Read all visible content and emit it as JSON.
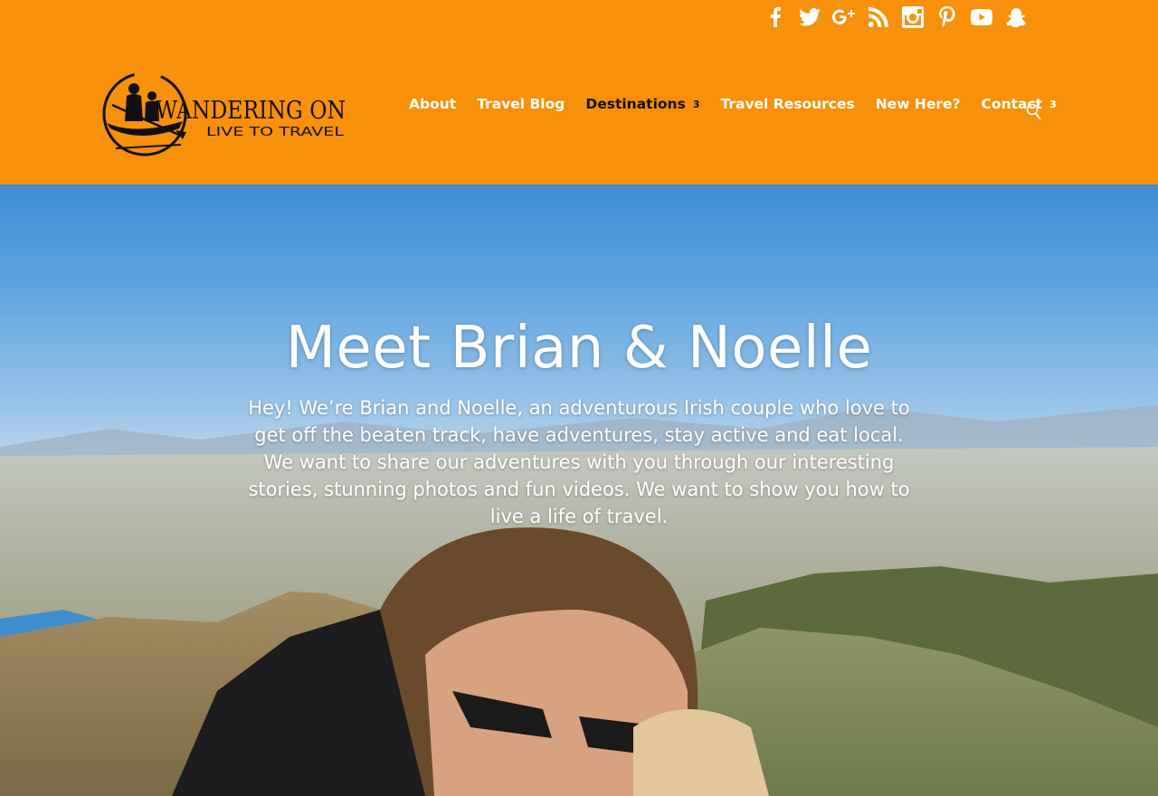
{
  "header": {
    "social": [
      {
        "icon": "facebook-icon"
      },
      {
        "icon": "twitter-icon"
      },
      {
        "icon": "google-plus-icon"
      },
      {
        "icon": "rss-icon"
      },
      {
        "icon": "instagram-icon"
      },
      {
        "icon": "pinterest-icon"
      },
      {
        "icon": "youtube-icon"
      },
      {
        "icon": "snapchat-icon"
      }
    ],
    "logo": {
      "main": "WANDERING ON",
      "tagline": "LIVE TO TRAVEL"
    },
    "nav": [
      {
        "label": "About"
      },
      {
        "label": "Travel Blog"
      },
      {
        "label": "Destinations",
        "chevron": "3"
      },
      {
        "label": "Travel Resources"
      },
      {
        "label": "New Here?"
      },
      {
        "label": "Contact",
        "chevron": "3"
      }
    ],
    "search_icon": "search-icon"
  },
  "hero": {
    "title": "Meet Brian & Noelle",
    "body": "Hey! We’re Brian and Noelle, an adventurous Irish couple who love to get off the beaten track, have adventures, stay active and eat local. We want to share our adventures with you through our interesting stories, stunning photos and fun videos. We want to show you how to live a life of travel."
  },
  "colors": {
    "accent": "#f7900a",
    "nav_text": "#ffffff",
    "nav_active": "#111111"
  }
}
